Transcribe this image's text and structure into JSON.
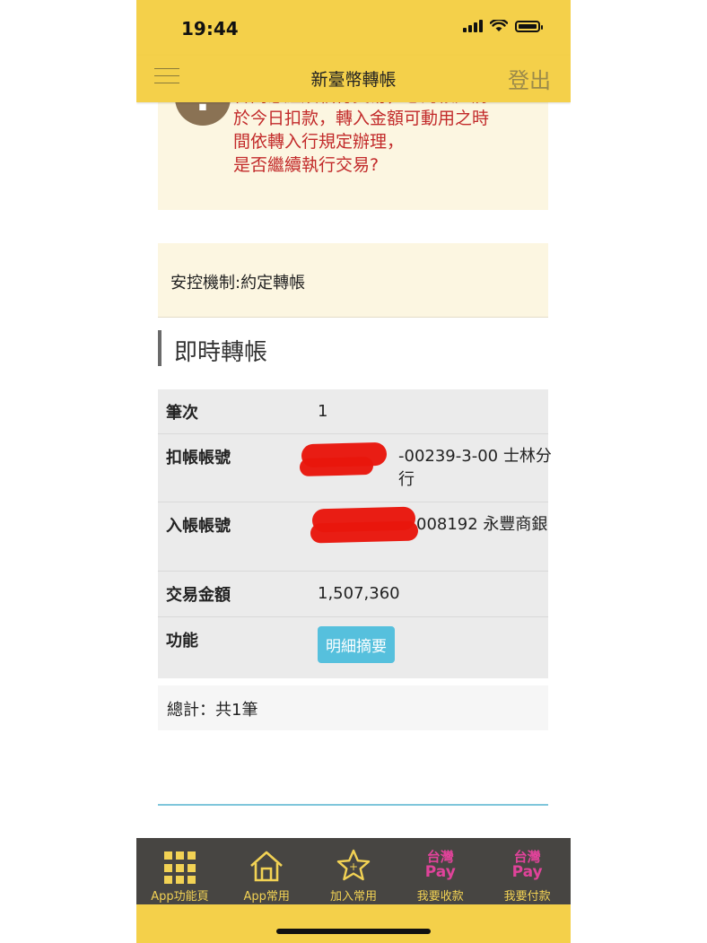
{
  "status_bar": {
    "time": "19:44"
  },
  "header": {
    "title": "新臺幣轉帳",
    "logout_label": "登出"
  },
  "warning": {
    "line1": "各同意繼續執行交易，您的帳戶將",
    "line2": "於今日扣款，轉入金額可動用之時",
    "line3": "間依轉入行規定辦理，",
    "line4": "是否繼續執行交易?"
  },
  "security": {
    "label": "安控機制:約定轉帳"
  },
  "section": {
    "title": "即時轉帳"
  },
  "details": {
    "batch_label": "筆次",
    "batch_value": "1",
    "debit_label": "扣帳帳號",
    "debit_value": "-00239-3-00 士林分行",
    "credit_label": "入帳帳號",
    "credit_value": "008192 永豐商銀",
    "amount_label": "交易金額",
    "amount_value": "1,507,360",
    "function_label": "功能",
    "detail_button": "明細摘要"
  },
  "total": {
    "label": "總計：共1筆"
  },
  "bottom_nav": {
    "items": [
      {
        "label": "App功能頁",
        "icon": "grid-icon"
      },
      {
        "label": "App常用",
        "icon": "home-icon"
      },
      {
        "label": "加入常用",
        "icon": "star-icon"
      },
      {
        "label": "我要收款",
        "icon": "taiwan-pay-icon",
        "logo_top": "台灣",
        "logo_bottom": "Pay"
      },
      {
        "label": "我要付款",
        "icon": "taiwan-pay-icon",
        "logo_top": "台灣",
        "logo_bottom": "Pay"
      }
    ]
  },
  "colors": {
    "header_yellow": "#f4d04a",
    "warning_red": "#c22a2a",
    "button_blue": "#56c0dd",
    "nav_dark": "#474542",
    "nav_label_yellow": "#f2d254",
    "pay_pink": "#e0439a"
  }
}
